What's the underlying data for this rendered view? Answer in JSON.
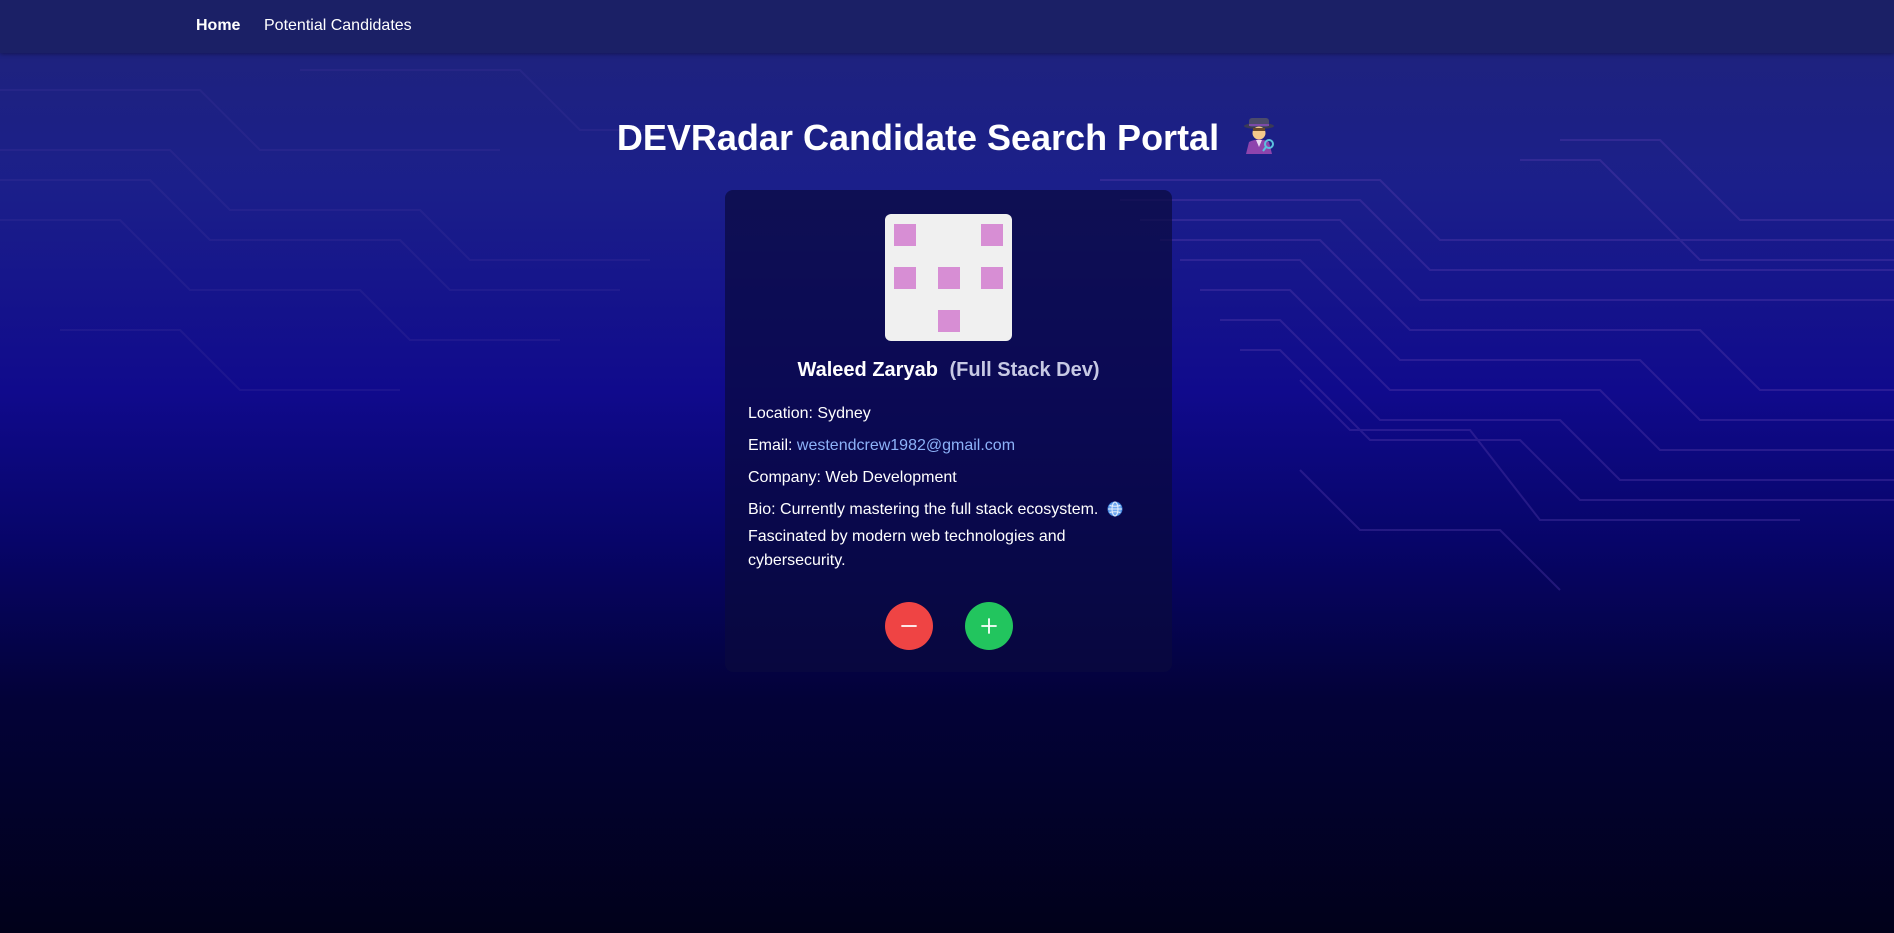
{
  "nav": {
    "home_label": "Home",
    "candidates_label": "Potential Candidates"
  },
  "page": {
    "title": "DEVRadar Candidate Search Portal",
    "title_icon": "detective-emoji-icon"
  },
  "candidate": {
    "name": "Waleed Zaryab",
    "role": "(Full Stack Dev)",
    "avatar_icon": "identicon-avatar",
    "avatar_colors": {
      "background": "#f0f0f0",
      "foreground": "#d78ed4"
    },
    "location_label": "Location:",
    "location": "Sydney",
    "email_label": "Email:",
    "email": "westendcrew1982@gmail.com",
    "company_label": "Company:",
    "company": "Web Development",
    "bio_label": "Bio:",
    "bio_part1": "Currently mastering the full stack ecosystem.",
    "bio_icon": "globe-icon",
    "bio_part2": "Fascinated by modern web technologies and cybersecurity."
  },
  "actions": {
    "reject_icon": "minus-icon",
    "accept_icon": "plus-icon",
    "reject_color": "#ef4444",
    "accept_color": "#22c55e"
  }
}
